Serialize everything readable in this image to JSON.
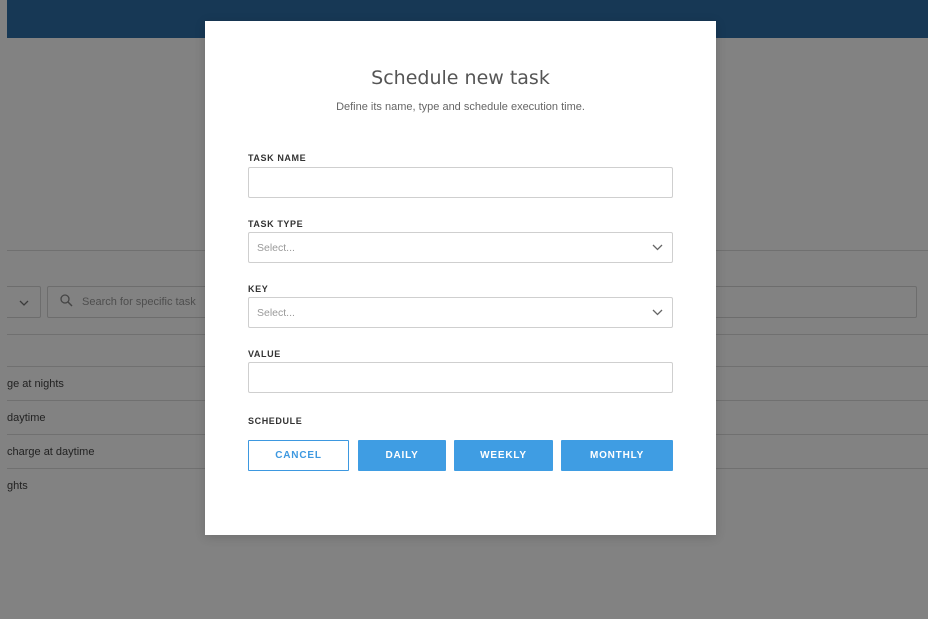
{
  "background": {
    "search_placeholder": "Search for specific task",
    "tasks": [
      "ge at nights",
      "daytime",
      "charge at daytime",
      "ghts"
    ]
  },
  "modal": {
    "title": "Schedule new task",
    "subtitle": "Define its name, type and schedule execution time.",
    "fields": {
      "task_name": {
        "label": "TASK NAME",
        "value": ""
      },
      "task_type": {
        "label": "TASK TYPE",
        "placeholder": "Select..."
      },
      "key": {
        "label": "KEY",
        "placeholder": "Select..."
      },
      "value": {
        "label": "VALUE",
        "value": ""
      }
    },
    "schedule_label": "SCHEDULE",
    "buttons": {
      "cancel": "CANCEL",
      "daily": "DAILY",
      "weekly": "WEEKLY",
      "monthly": "MONTHLY"
    }
  },
  "colors": {
    "header": "#2e6fa7",
    "accent": "#3f9de3",
    "overlay": "rgba(0,0,0,0.49)"
  }
}
